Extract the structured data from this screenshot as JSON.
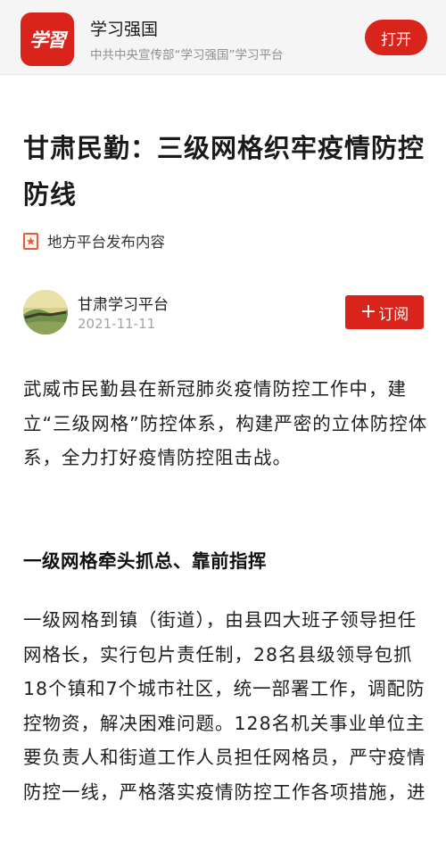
{
  "banner": {
    "logo_text": "学習",
    "app_name": "学习强国",
    "slogan": "中共中央宣传部“学习强国”学习平台",
    "open_label": "打开",
    "brand_color": "#d9241c"
  },
  "article": {
    "title": "甘肃民勤：三级网格织牢疫情防控防线",
    "source_tag": "地方平台发布内容",
    "source_tag_icon": "star-badge-icon",
    "author": {
      "name": "甘肃学习平台",
      "date": "2021-11-11",
      "subscribe_label": "订阅",
      "subscribe_icon": "plus-icon"
    },
    "intro": "武威市民勤县在新冠肺炎疫情防控工作中，建立“三级网格”防控体系，构建严密的立体防控体系，全力打好疫情防控阻击战。",
    "section_heading": "一级网格牵头抓总、靠前指挥",
    "section_body": "一级网格到镇（街道），由县四大班子领导担任网格长，实行包片责任制，28名县级领导包抓18个镇和7个城市社区，统一部署工作，调配防控物资，解决困难问题。128名机关事业单位主要负责人和街道工作人员担任网格员，严守疫情防控一线，严格落实疫情防控工作各项措施，进"
  }
}
